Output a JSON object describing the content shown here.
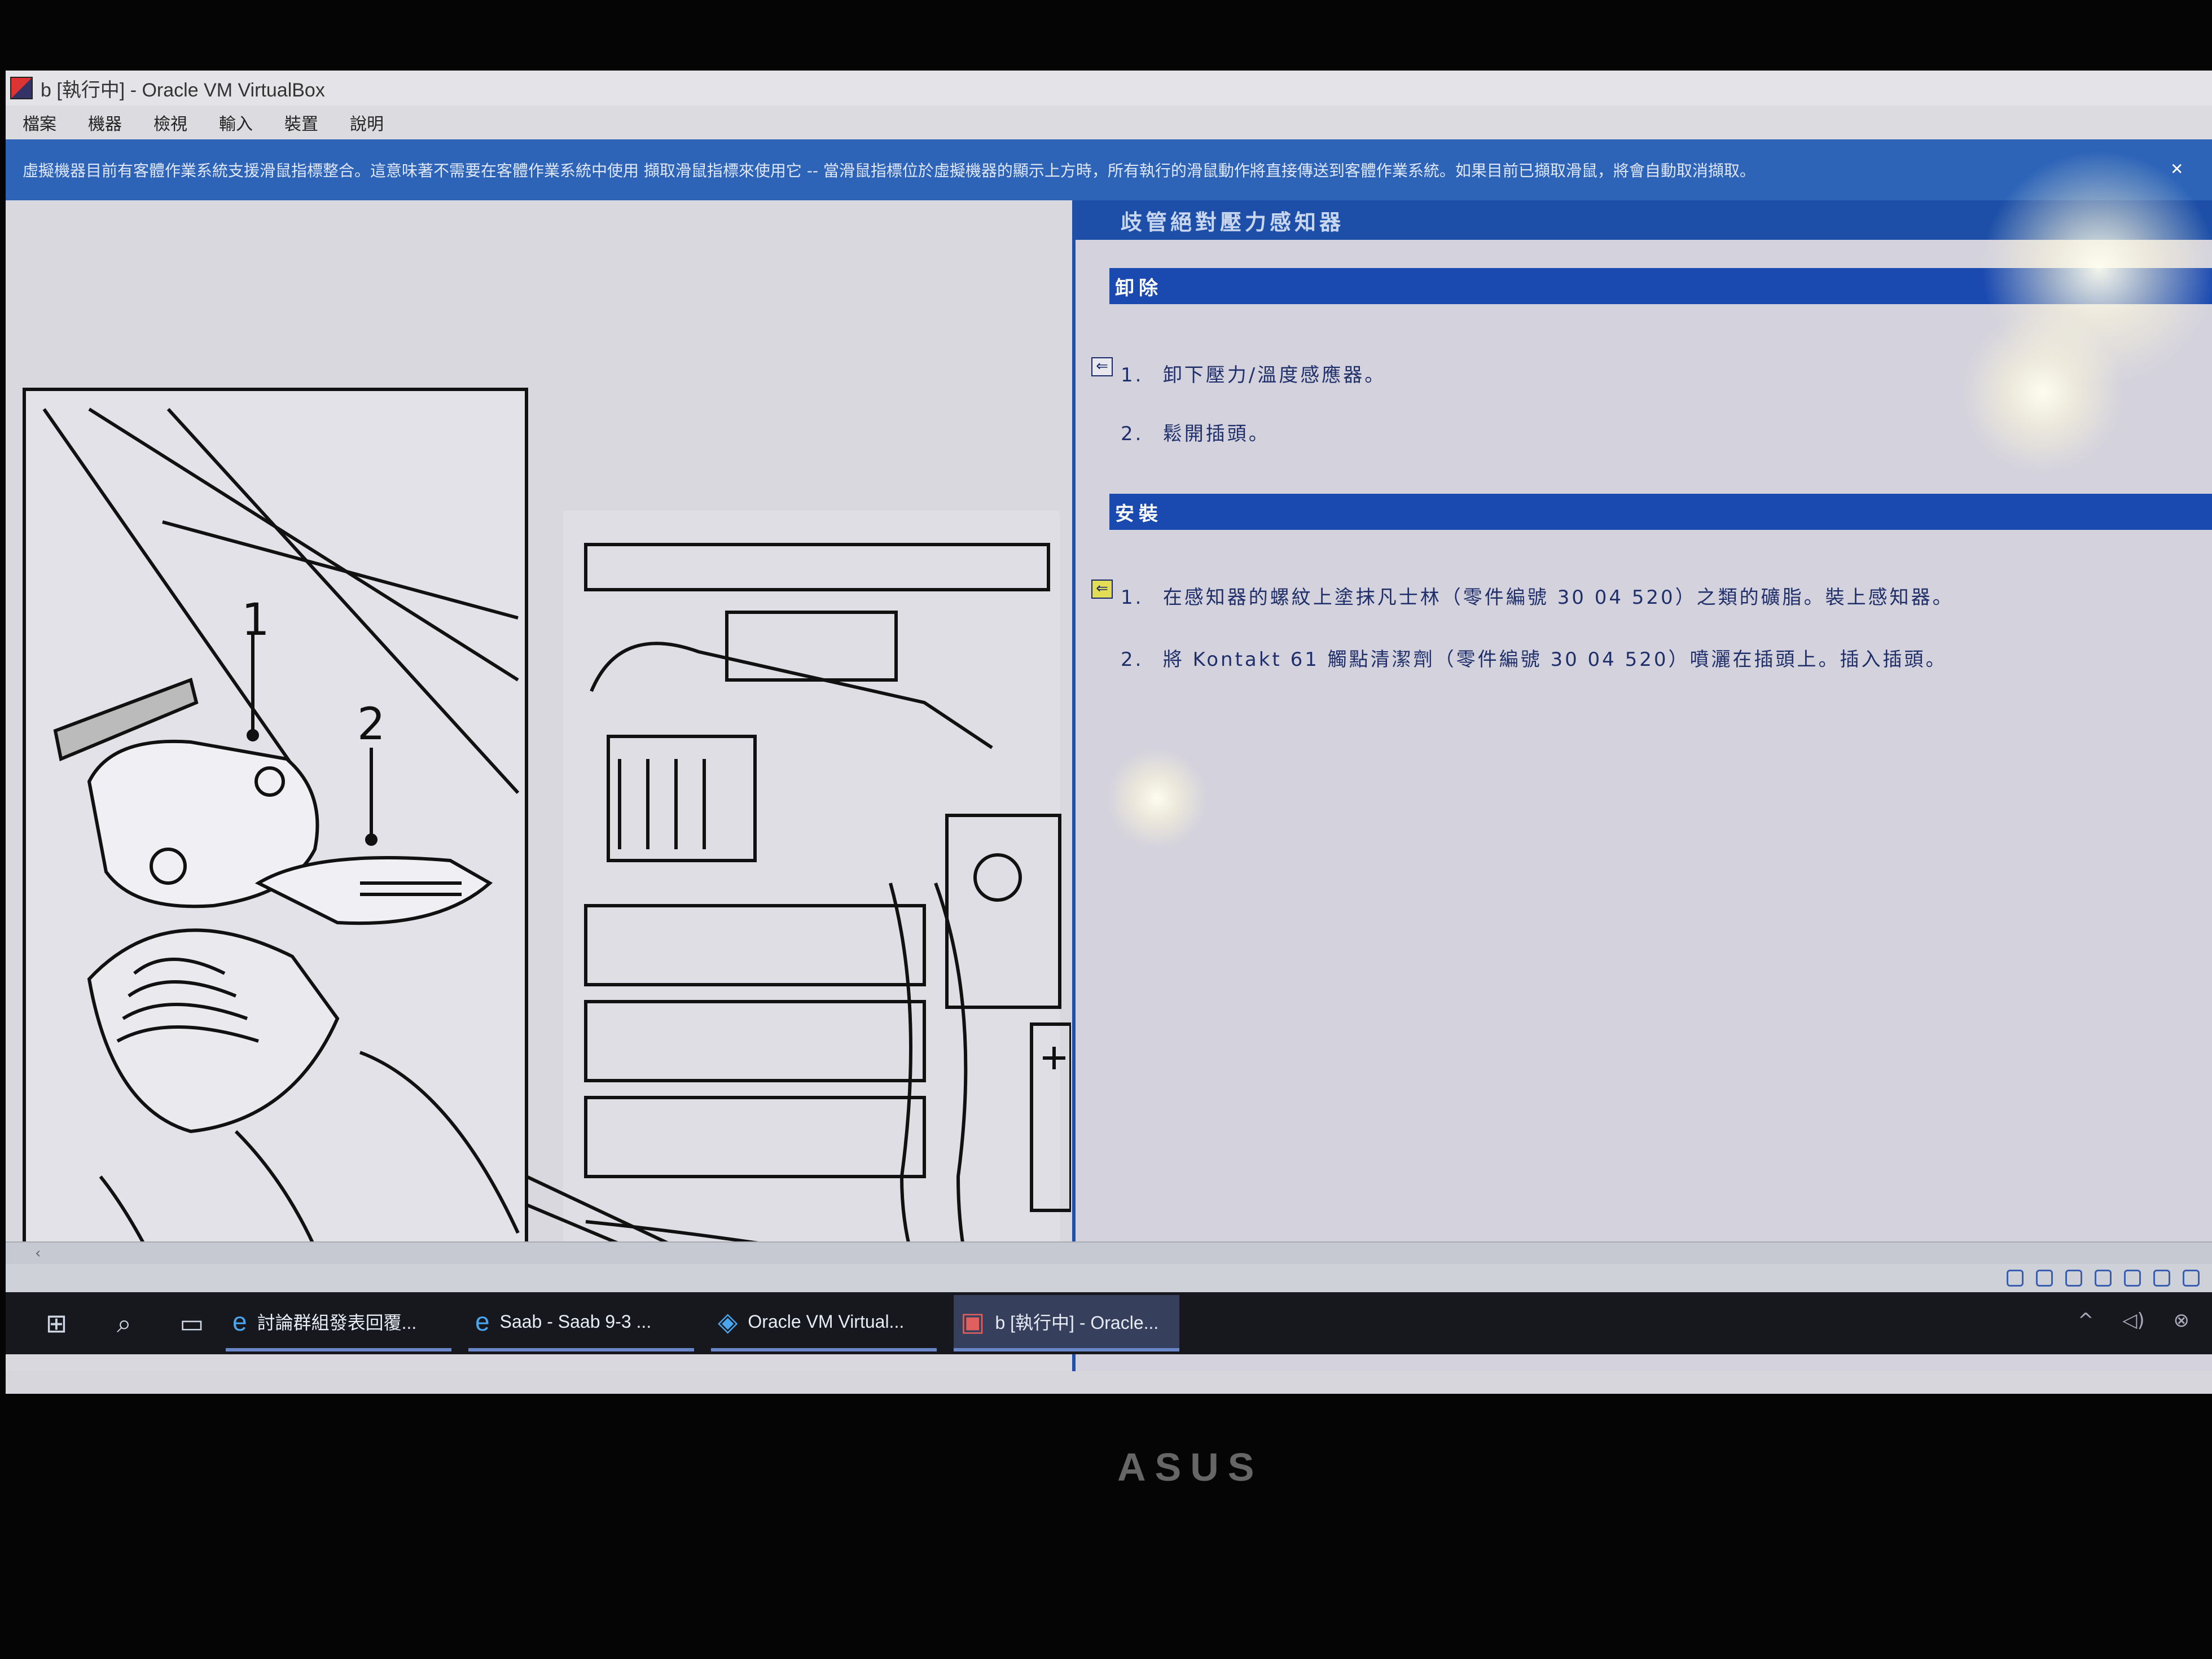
{
  "window": {
    "title": "b [執行中] - Oracle VM VirtualBox"
  },
  "menu": [
    "檔案",
    "機器",
    "檢視",
    "輸入",
    "裝置",
    "說明"
  ],
  "notice_text": "虛擬機器目前有客體作業系統支援滑鼠指標整合。這意味著不需要在客體作業系統中使用 擷取滑鼠指標來使用它 -- 當滑鼠指標位於虛擬機器的顯示上方時，所有執行的滑鼠動作將直接傳送到客體作業系統。如果目前已擷取滑鼠，將會自動取消擷取。",
  "document": {
    "title": "歧管絕對壓力感知器",
    "removal": {
      "heading": "卸除",
      "steps": [
        {
          "num": "1.",
          "text": "卸下壓力/溫度感應器。"
        },
        {
          "num": "2.",
          "text": "鬆開插頭。"
        }
      ]
    },
    "install": {
      "heading": "安裝",
      "steps": [
        {
          "num": "1.",
          "text": "在感知器的螺紋上塗抹凡士林（零件編號 30 04 520）之類的礦脂。裝上感知器。"
        },
        {
          "num": "2.",
          "text": "將 Kontakt 61 觸點清潔劑（零件編號 30 04 520）噴灑在插頭上。插入插頭。"
        }
      ]
    }
  },
  "illustration": {
    "callout_1": "1",
    "callout_2": "2"
  },
  "taskbar": {
    "apps": [
      {
        "label": "討論群組發表回覆...",
        "icon": "ie-icon",
        "active": false
      },
      {
        "label": "Saab - Saab 9-3 ...",
        "icon": "ie-icon",
        "active": false
      },
      {
        "label": "Oracle VM Virtual...",
        "icon": "virtualbox-icon",
        "active": false
      },
      {
        "label": "b [執行中] - Oracle...",
        "icon": "vm-icon",
        "active": true
      }
    ]
  },
  "bezel_brand": "ASUS",
  "colors": {
    "accent": "#1a49b0",
    "notice_bg": "#2d64b8",
    "taskbar": "#17181e"
  }
}
